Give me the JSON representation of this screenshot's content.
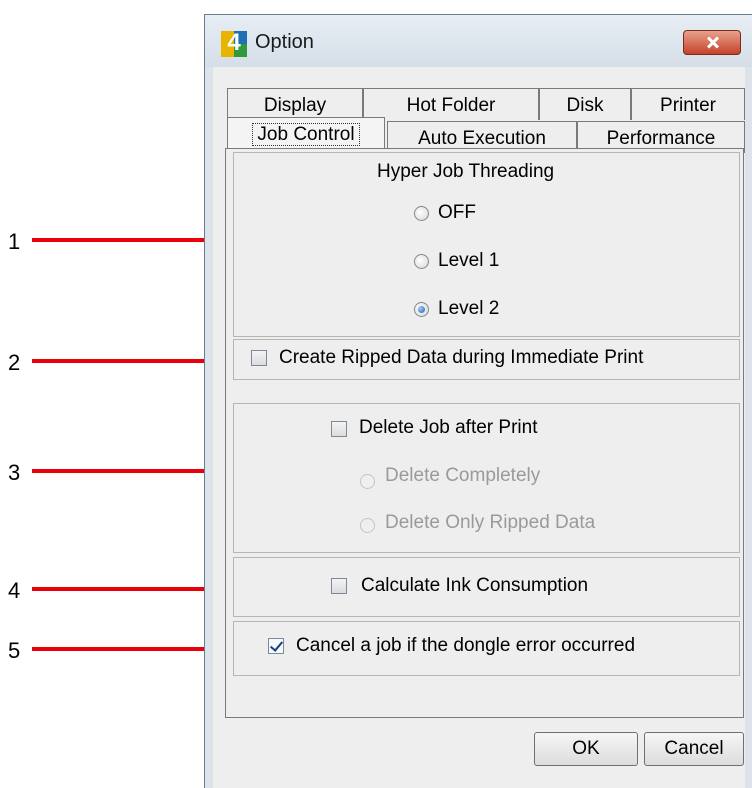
{
  "callouts": [
    {
      "number": "1"
    },
    {
      "number": "2"
    },
    {
      "number": "3"
    },
    {
      "number": "4"
    },
    {
      "number": "5"
    }
  ],
  "window": {
    "title": "Option",
    "icon_digit": "4"
  },
  "tabs": {
    "back_row": [
      {
        "label": "Display"
      },
      {
        "label": "Hot Folder"
      },
      {
        "label": "Disk"
      },
      {
        "label": "Printer"
      }
    ],
    "front_row": [
      {
        "label": "Job Control",
        "active": true
      },
      {
        "label": "Auto Execution"
      },
      {
        "label": "Performance"
      }
    ]
  },
  "job_control": {
    "hyper_threading": {
      "title": "Hyper Job Threading",
      "options": [
        {
          "label": "OFF",
          "selected": false
        },
        {
          "label": "Level 1",
          "selected": false
        },
        {
          "label": "Level 2",
          "selected": true
        }
      ]
    },
    "create_ripped": {
      "label": "Create Ripped Data during Immediate Print",
      "checked": false
    },
    "delete_job": {
      "label": "Delete Job after Print",
      "checked": false,
      "options": [
        {
          "label": "Delete Completely",
          "enabled": false
        },
        {
          "label": "Delete Only Ripped Data",
          "enabled": false
        }
      ]
    },
    "calc_ink": {
      "label": "Calculate Ink Consumption",
      "checked": false
    },
    "cancel_dongle": {
      "label": "Cancel a job if the dongle error occurred",
      "checked": true
    }
  },
  "buttons": {
    "ok": "OK",
    "cancel": "Cancel"
  },
  "colors": {
    "callout_line": "#e8000b",
    "accent": "#1f6fb4"
  }
}
